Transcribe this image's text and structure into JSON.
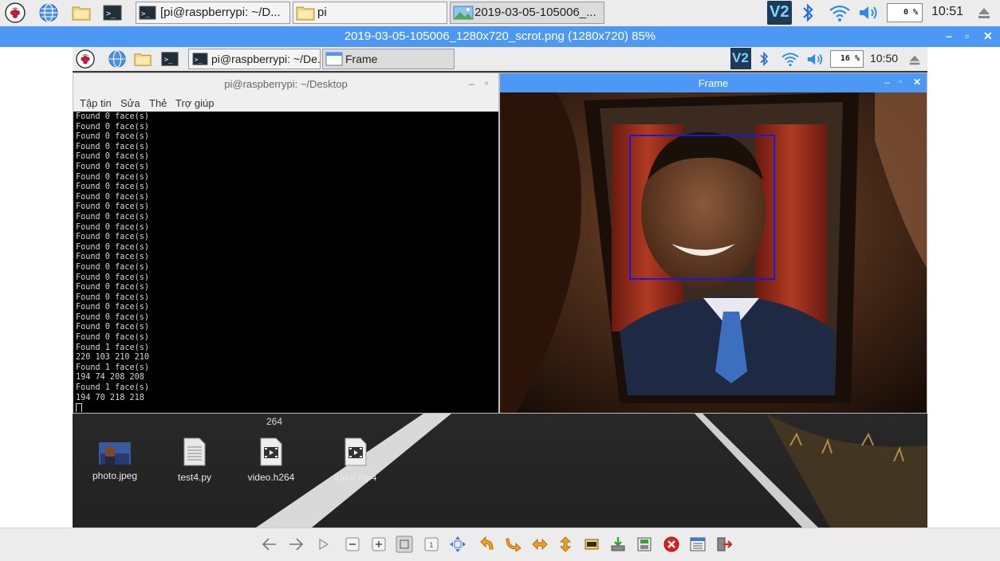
{
  "outer_taskbar": {
    "tasks": [
      {
        "label": "[pi@raspberrypi: ~/D..."
      },
      {
        "label": "pi"
      },
      {
        "label": "2019-03-05-105006_..."
      }
    ],
    "cpu": "0 %",
    "clock": "10:51",
    "vnc_label": "V2"
  },
  "viewer": {
    "title": "2019-03-05-105006_1280x720_scrot.png (1280x720) 85%",
    "controls": [
      "–",
      "▫",
      "✕"
    ]
  },
  "inner_taskbar": {
    "tasks": [
      {
        "label": "pi@raspberrypi: ~/De..."
      },
      {
        "label": "Frame"
      }
    ],
    "cpu": "16 %",
    "clock": "10:50",
    "vnc_label": "V2"
  },
  "terminal": {
    "title": "pi@raspberrypi: ~/Desktop",
    "menu": [
      "Tập tin",
      "Sửa",
      "Thẻ",
      "Trợ giúp"
    ],
    "output": "Found 0 face(s)\nFound 0 face(s)\nFound 0 face(s)\nFound 0 face(s)\nFound 0 face(s)\nFound 0 face(s)\nFound 0 face(s)\nFound 0 face(s)\nFound 0 face(s)\nFound 0 face(s)\nFound 0 face(s)\nFound 0 face(s)\nFound 0 face(s)\nFound 0 face(s)\nFound 0 face(s)\nFound 0 face(s)\nFound 0 face(s)\nFound 0 face(s)\nFound 0 face(s)\nFound 0 face(s)\nFound 0 face(s)\nFound 0 face(s)\nFound 0 face(s)\nFound 1 face(s)\n220 103 210 210\nFound 1 face(s)\n194 74 208 208\nFound 1 face(s)\n194 70 218 218\n"
  },
  "frame_window": {
    "title": "Frame"
  },
  "desktop": {
    "label_264": "264",
    "icons": [
      {
        "label": "photo.jpeg",
        "icon": "image-file-icon"
      },
      {
        "label": "test4.py",
        "icon": "text-file-icon"
      },
      {
        "label": "video.h264",
        "icon": "video-file-icon"
      },
      {
        "label": "input.mp4",
        "icon": "video-file-icon"
      }
    ]
  },
  "toolbar": {
    "buttons": [
      "back",
      "forward",
      "play",
      "zoom-out",
      "zoom-in",
      "zoom-fit",
      "zoom-original",
      "fullscreen",
      "rotate-left",
      "rotate-right",
      "flip-horizontal",
      "flip-vertical",
      "open",
      "save",
      "save-as",
      "delete",
      "preferences",
      "exit"
    ]
  },
  "colors": {
    "accent": "#4d98f5",
    "face_box": "#1a18e0"
  }
}
